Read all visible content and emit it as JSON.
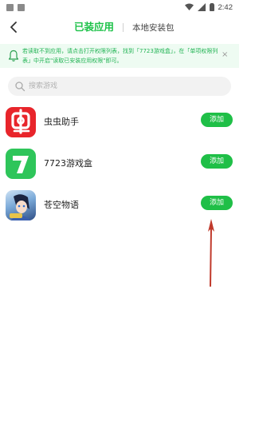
{
  "status_bar": {
    "time": "2:42",
    "icons": [
      "notification-icon",
      "image-icon",
      "wifi-icon",
      "signal-icon",
      "battery-icon"
    ]
  },
  "header": {
    "back_icon": "chevron-left-icon",
    "tabs": [
      {
        "label": "已装应用",
        "active": true
      },
      {
        "label": "本地安装包",
        "active": false
      }
    ]
  },
  "notice": {
    "icon": "bell-icon",
    "text": "若读取不到应用，请点击打开权限列表，找到「7723游戏盒」，在「单项权限列表」中开启\"读取已安装应用权限\"即可。",
    "close_label": "×"
  },
  "search": {
    "placeholder": "搜索游戏",
    "value": ""
  },
  "apps": [
    {
      "name": "虫虫助手",
      "button": "添加"
    },
    {
      "name": "7723游戏盒",
      "button": "添加"
    },
    {
      "name": "苍空物语",
      "button": "添加"
    }
  ],
  "colors": {
    "accent": "#1fbf47",
    "notice_bg": "#eefbf2",
    "annotation_arrow": "#c0392b"
  }
}
